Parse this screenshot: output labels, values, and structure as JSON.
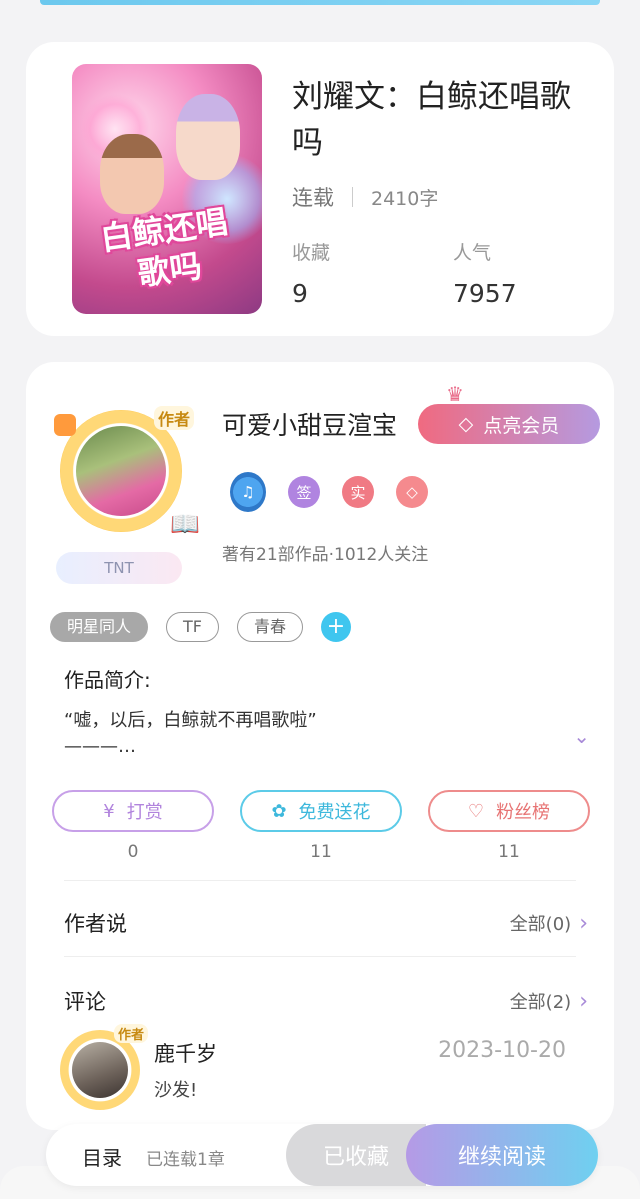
{
  "book": {
    "title": "刘耀文：白鲸还唱歌吗",
    "cover_text": "白鲸还唱歌吗",
    "status": "连载",
    "word_count": "2410字",
    "favorites_label": "收藏",
    "favorites_value": "9",
    "popularity_label": "人气",
    "popularity_value": "7957"
  },
  "author": {
    "name": "可爱小甜豆渲宝",
    "avatar_tag": "作者",
    "fan_label": "TNT",
    "vip_button": "点亮会员",
    "badges": {
      "sign": "签",
      "real": "实"
    },
    "works_info": "著有21部作品·1012人关注"
  },
  "tags": [
    "明星同人",
    "TF",
    "青春"
  ],
  "tag_add": "+",
  "intro": {
    "title": "作品简介:",
    "text": "“嘘，以后，白鲸就不再唱歌啦”\n———…"
  },
  "actions": {
    "tip": {
      "label": "打赏",
      "count": "0"
    },
    "flower": {
      "label": "免费送花",
      "count": "11"
    },
    "fans": {
      "label": "粉丝榜",
      "count": "11"
    }
  },
  "author_says": {
    "title": "作者说",
    "more": "全部(0)"
  },
  "comments": {
    "title": "评论",
    "more": "全部(2)",
    "first": {
      "user": "鹿千岁",
      "avatar_tag": "作者",
      "date": "2023-10-20",
      "text": "沙发!"
    }
  },
  "bottom_bar": {
    "toc": "目录",
    "chapters": "已连载1章",
    "saved": "已收藏",
    "read": "继续阅读"
  },
  "colors": {
    "accent_blue": "#3fc6ef",
    "accent_purple": "#b184dd",
    "accent_red": "#e77474"
  }
}
